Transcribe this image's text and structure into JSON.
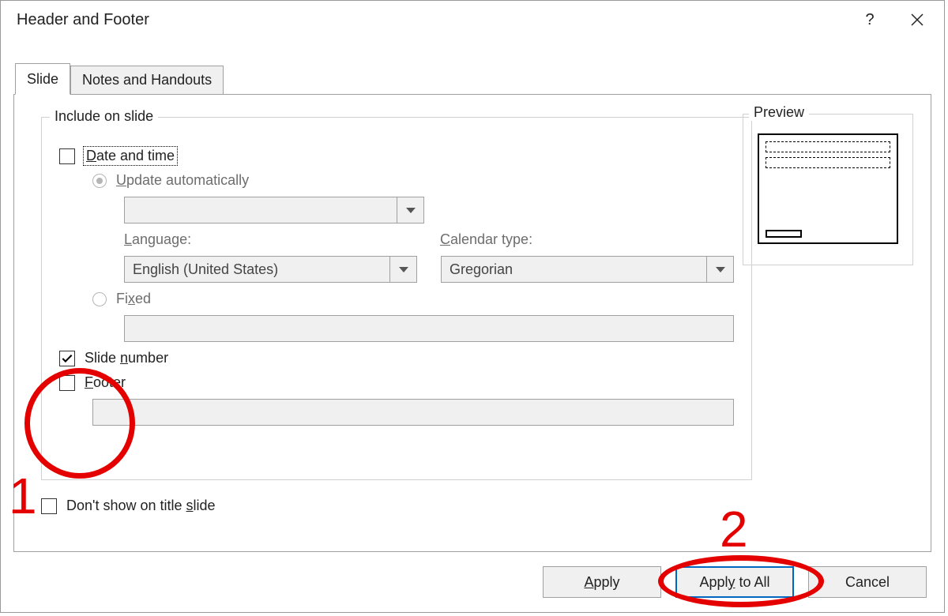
{
  "dialog": {
    "title": "Header and Footer"
  },
  "tabs": {
    "slide": "Slide",
    "notes": "Notes and Handouts"
  },
  "group": {
    "include_legend": "Include on slide",
    "preview_legend": "Preview"
  },
  "options": {
    "date_time": "Date and time",
    "update_auto": "Update automatically",
    "language_label": "Language:",
    "language_value": "English (United States)",
    "calendar_label": "Calendar type:",
    "calendar_value": "Gregorian",
    "fixed": "Fixed",
    "slide_number": "Slide number",
    "footer": "Footer",
    "dont_show_title": "Don't show on title slide"
  },
  "buttons": {
    "apply": "Apply",
    "apply_all": "Apply to All",
    "cancel": "Cancel"
  },
  "annotations": {
    "one": "1",
    "two": "2"
  }
}
